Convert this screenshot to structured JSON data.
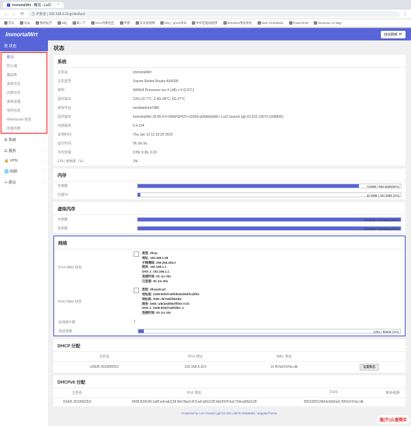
{
  "browser": {
    "tab_title": "ImmortalWrt - 概况 - LuCI",
    "url_prefix": "不安全",
    "url": "192.168.6.1/cgi-bin/luci/",
    "bookmarks": [
      "京东",
      "论坛",
      "我的帖子",
      "B站",
      "来一下",
      "NGA玩家社区",
      "手游",
      "天天省钱销",
      "blog - gmor绿洲",
      "中华区驱动程序",
      "Windows预览体验",
      "New VirtualDisk",
      "PowerShell",
      "Windows 11 Migr"
    ]
  },
  "header": {
    "brand": "ImmortalWrt",
    "refresh": "自动刷新 开"
  },
  "sidebar": {
    "status": "状态",
    "subs": [
      "概况",
      "防火墙",
      "路由表",
      "系统日志",
      "内核日志",
      "系统进程",
      "实时信息",
      "WireGuard 状态",
      "负载均衡"
    ],
    "items": [
      "系统",
      "服务",
      "VPN",
      "网络",
      "退出"
    ]
  },
  "page_title": "状态",
  "system": {
    "title": "系统",
    "rows": [
      {
        "l": "主机名",
        "v": "ImmortalWrt"
      },
      {
        "l": "主机型号",
        "v": "Xiaomi Redmi Router AX6000"
      },
      {
        "l": "架构",
        "v": "ARMv8 Processor rev 4 (v8l) x 4 (2.0°C)"
      },
      {
        "l": "固件版本",
        "v": "CPU-32.7°C, 2.4G-28°C, 5G-27°C"
      },
      {
        "l": "目标平台",
        "v": "mediatek/mt7986"
      },
      {
        "l": "固件版本",
        "v": "ImmortalWrt 18.06-5.4-SNAPSHOT-r11894-a05db6ed60 / LuCI branch (git-23.323.13670-1938836)"
      },
      {
        "l": "内核版本",
        "v": "5.4.224"
      },
      {
        "l": "本地时间",
        "v": "Thu Jan 12 11:10:29 2023"
      },
      {
        "l": "运行时间",
        "v": "0h 2m 9s"
      },
      {
        "l": "平均负载",
        "v": "0.58, 0.36, 0.19"
      },
      {
        "l": "CPU 使用率（%）",
        "v": "2%"
      }
    ]
  },
  "memory": {
    "title": "内存",
    "rows": [
      {
        "l": "可用数",
        "pct": 84,
        "text": "719MB / 866.5MB(84%)"
      },
      {
        "l": "已缓冲",
        "pct": 1,
        "text": "10.9MB / 402.5MB (2%)"
      }
    ]
  },
  "swap": {
    "title": "虚拟内存",
    "rows": [
      {
        "l": "可用数",
        "pct": 100,
        "text": "2013MB / 2013MB(100%)"
      },
      {
        "l": "空闲数",
        "pct": 100,
        "text": "2013MB / 2013MB(100%)"
      }
    ]
  },
  "network": {
    "title": "网络",
    "wan4": {
      "label": "IPv4 WAN 状态",
      "type": "类型: dhcp",
      "addr": "地址: 192.168.1.49",
      "mask": "子网掩码: 255.255.255.0",
      "gw": "网关: 192.168.1.1",
      "dns": "DNS 1: 192.168.1.1",
      "conn": "连接时间: 0h 1m 30s",
      "expire": "已连接: 0h 1m 30s"
    },
    "wan6": {
      "label": "IPv6 WAN 状态",
      "type": "类型: dhcpv6-pd",
      "addr": "地址段: 2408:82/6/7a5f/d54/2283/fc18/52",
      "pd": "地址段: fe80::/6/7a5f/d54/64",
      "gw": "网关: fe80::1/6/4ed9/8eff/fe0:7cf3",
      "dns": "DNS 1: 2408:82/6/7a5f/d54::1",
      "conn": "连接时间: 0h 1m 30s"
    },
    "online": {
      "l": "在线用户数",
      "v": "1"
    },
    "active": {
      "l": "活动连接",
      "pct": 2,
      "text": "1261 / 65536 (1%)"
    }
  },
  "dhcp": {
    "title": "DHCP 分配",
    "cols": [
      "主机名",
      "IPv4 地址",
      "MAC 地址",
      ""
    ],
    "rows": [
      {
        "host": "USER-20190625IJ",
        "ip": "192.168.6.114",
        "mac": "2c:f0:5d:61f:bc:db",
        "btn": "设置静态"
      }
    ]
  },
  "dhcpv6": {
    "title": "DHCPv6 分配",
    "cols": [
      "主机名",
      "IPv6 地址",
      "DUID",
      "剩余租期"
    ],
    "rows": [
      {
        "host": "USER-20190625IJ",
        "ip": "2408:82/6/30:1a5f:a4cab/128 fdcf:8ac0-8:0:a4:a5b/128 fdd:81f/0:bd:72dca65b/128",
        "duid": "0001000128d:bo5b0a2c:f05d:61f:bc:db",
        "lease": ""
      }
    ]
  },
  "footer": "Powered by LuCI branch (git-23.323.13670-1938836) / angularTheme",
  "watermark": "值(什)么值得买"
}
